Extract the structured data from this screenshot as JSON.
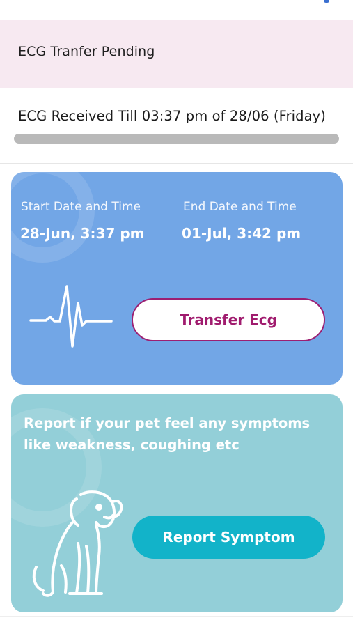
{
  "pending": {
    "text": "ECG Tranfer Pending"
  },
  "received": {
    "text": "ECG Received Till 03:37 pm of 28/06 (Friday)",
    "progress_fraction": 1.0
  },
  "ecg_card": {
    "start_label": "Start Date and Time",
    "start_value": "28-Jun, 3:37 pm",
    "end_label": "End Date and Time",
    "end_value": "01-Jul, 3:42 pm",
    "button_label": "Transfer Ecg",
    "icon": "ecg-wave-icon",
    "color": "#72a6e6",
    "button_text_color": "#a01b6e"
  },
  "symptom_card": {
    "text": "Report if your pet feel any symptoms like weakness, coughing etc",
    "button_label": "Report Symptom",
    "icon": "dog-icon",
    "color": "#93cfd8",
    "button_color": "#12b3c9"
  }
}
